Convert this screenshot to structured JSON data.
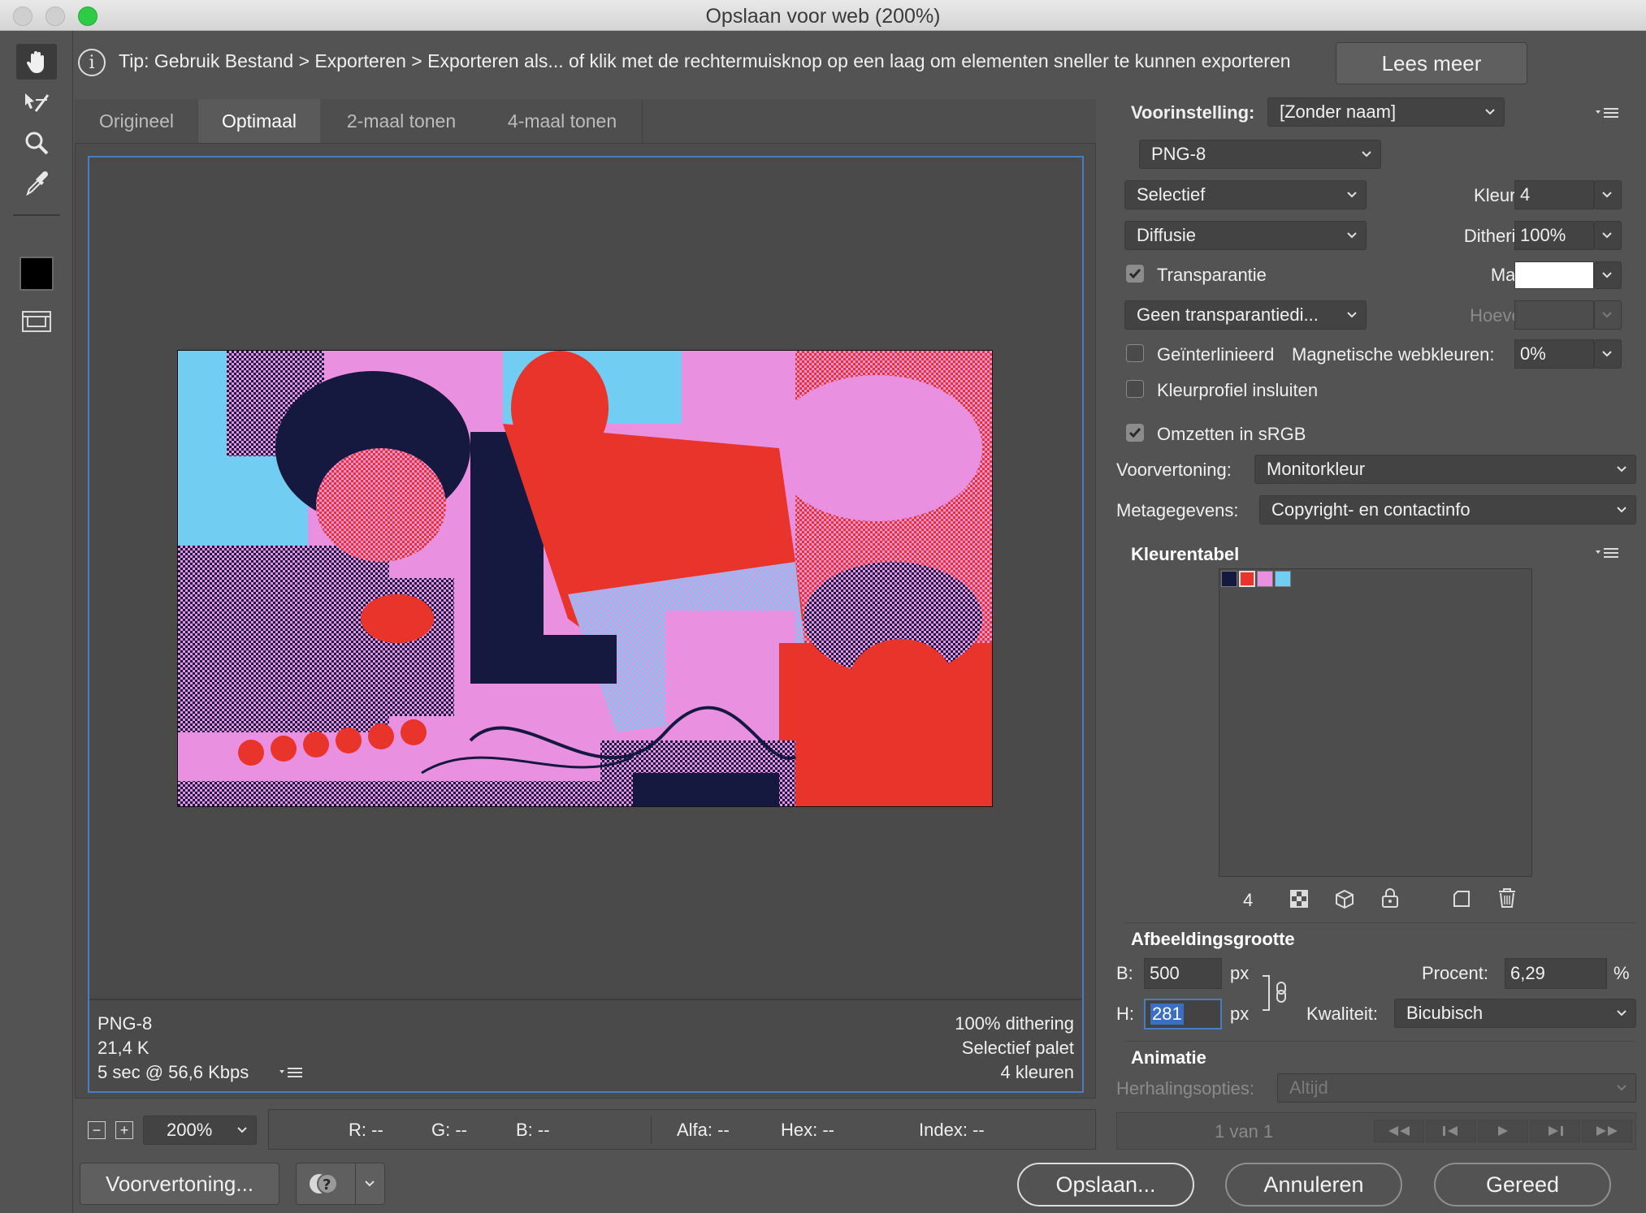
{
  "window": {
    "title": "Opslaan voor web (200%)"
  },
  "tip": {
    "text": "Tip: Gebruik Bestand > Exporteren > Exporteren als... of klik met de rechtermuisknop op een laag om elementen sneller te kunnen exporteren",
    "button": "Lees meer"
  },
  "tabs": [
    "Origineel",
    "Optimaal",
    "2-maal tonen",
    "4-maal tonen"
  ],
  "preview": {
    "format": "PNG-8",
    "size": "21,4 K",
    "time": "5 sec @ 56,6 Kbps",
    "dithering": "100% dithering",
    "palette": "Selectief palet",
    "colors": "4 kleuren"
  },
  "settings": {
    "preset_label": "Voorinstelling:",
    "preset_value": "[Zonder naam]",
    "format": "PNG-8",
    "reduction": "Selectief",
    "colors_label": "Kleuren:",
    "colors_value": "4",
    "dither_method": "Diffusie",
    "dither_label": "Dithering:",
    "dither_value": "100%",
    "transparency_label": "Transparantie",
    "transparency_checked": true,
    "matte_label": "Matte:",
    "matte_color": "#ffffff",
    "trans_dither": "Geen transparantiedi...",
    "amount_label": "Hoeveel:",
    "interlaced_label": "Geïnterlinieerd",
    "websnap_label": "Magnetische webkleuren:",
    "websnap_value": "0%",
    "embed_profile_label": "Kleurprofiel insluiten",
    "srgb_label": "Omzetten in sRGB",
    "preview_label": "Voorvertoning:",
    "preview_value": "Monitorkleur",
    "metadata_label": "Metagegevens:",
    "metadata_value": "Copyright- en contactinfo"
  },
  "color_table": {
    "title": "Kleurentabel",
    "count": "4",
    "swatches": [
      "#15183f",
      "#e8342a",
      "#ea90e0",
      "#72cdf2"
    ]
  },
  "image_size": {
    "title": "Afbeeldingsgrootte",
    "width_label": "B:",
    "width": "500",
    "height_label": "H:",
    "height": "281",
    "unit": "px",
    "percent_label": "Procent:",
    "percent": "6,29",
    "percent_sign": "%",
    "quality_label": "Kwaliteit:",
    "quality": "Bicubisch"
  },
  "animation": {
    "title": "Animatie",
    "loop_label": "Herhalingsopties:",
    "loop_value": "Altijd",
    "frame": "1 van 1"
  },
  "statusbar": {
    "zoom": "200%",
    "r": "R: --",
    "g": "G: --",
    "b": "B: --",
    "alpha": "Alfa: --",
    "hex": "Hex: --",
    "index": "Index: --"
  },
  "buttons": {
    "preview": "Voorvertoning...",
    "save": "Opslaan...",
    "cancel": "Annuleren",
    "done": "Gereed"
  }
}
